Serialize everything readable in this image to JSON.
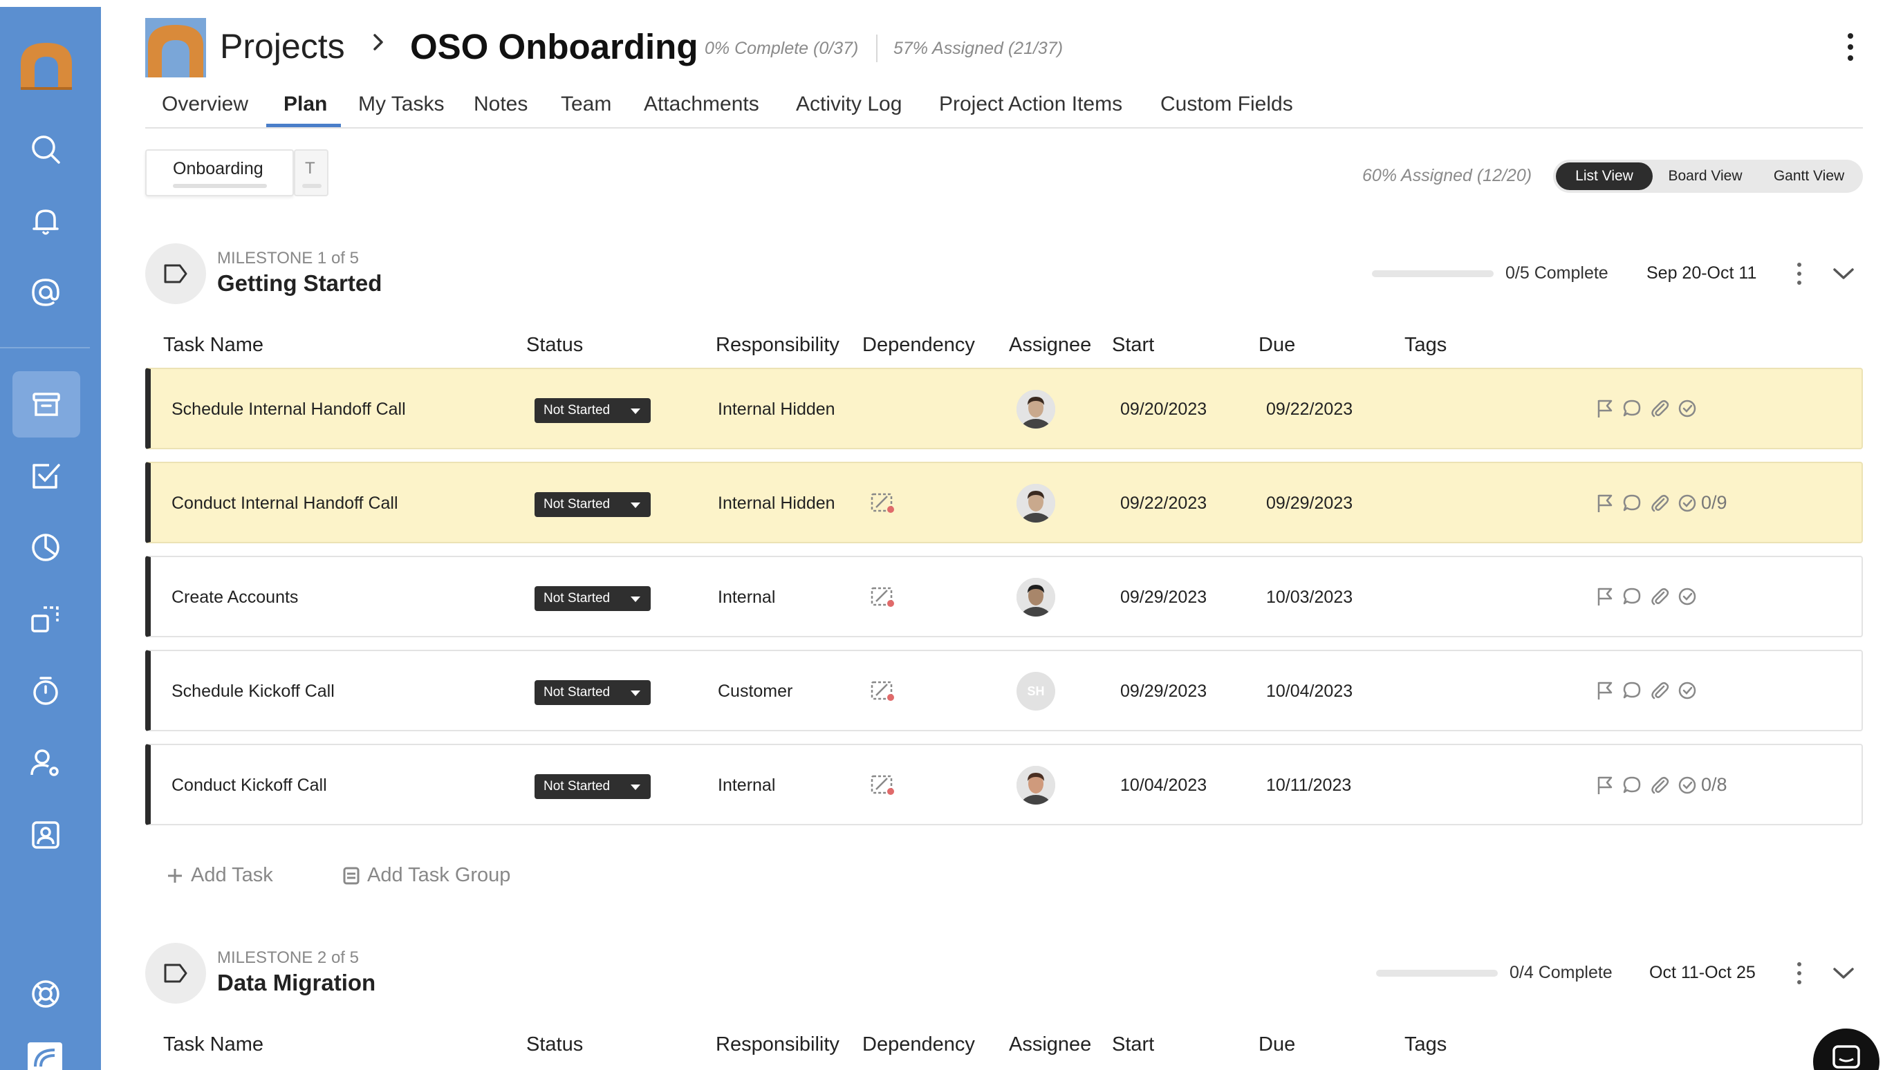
{
  "header": {
    "crumb_root": "Projects",
    "project_title": "OSO Onboarding",
    "complete_stat": "0% Complete (0/37)",
    "assigned_stat": "57% Assigned (21/37)"
  },
  "tabs": [
    "Overview",
    "Plan",
    "My Tasks",
    "Notes",
    "Team",
    "Attachments",
    "Activity Log",
    "Project Action Items",
    "Custom Fields"
  ],
  "active_tab": "Plan",
  "plan_tabs": {
    "first": "Onboarding",
    "second": "T"
  },
  "plan_assigned": "60% Assigned (12/20)",
  "views": {
    "list": "List View",
    "board": "Board View",
    "gantt": "Gantt View",
    "active": "List View"
  },
  "columns": {
    "task_name": "Task Name",
    "status": "Status",
    "responsibility": "Responsibility",
    "dependency": "Dependency",
    "assignee": "Assignee",
    "start": "Start",
    "due": "Due",
    "tags": "Tags"
  },
  "milestones": [
    {
      "label": "MILESTONE 1 of 5",
      "name": "Getting Started",
      "complete": "0/5 Complete",
      "dates": "Sep 20-Oct 11",
      "progress": 0
    },
    {
      "label": "MILESTONE 2 of 5",
      "name": "Data Migration",
      "complete": "0/4 Complete",
      "dates": "Oct 11-Oct 25",
      "progress": 0
    }
  ],
  "tasks": [
    {
      "name": "Schedule Internal Handoff Call",
      "status": "Not Started",
      "responsibility": "Internal Hidden",
      "dependency": false,
      "assignee": "avatar-1",
      "start": "09/20/2023",
      "due": "09/22/2023",
      "checklist": "",
      "highlight": true
    },
    {
      "name": "Conduct Internal Handoff Call",
      "status": "Not Started",
      "responsibility": "Internal Hidden",
      "dependency": true,
      "assignee": "avatar-1",
      "start": "09/22/2023",
      "due": "09/29/2023",
      "checklist": "0/9",
      "highlight": true
    },
    {
      "name": "Create Accounts",
      "status": "Not Started",
      "responsibility": "Internal",
      "dependency": true,
      "assignee": "avatar-2",
      "start": "09/29/2023",
      "due": "10/03/2023",
      "checklist": "",
      "highlight": false
    },
    {
      "name": "Schedule Kickoff Call",
      "status": "Not Started",
      "responsibility": "Customer",
      "dependency": true,
      "assignee": "SH",
      "start": "09/29/2023",
      "due": "10/04/2023",
      "checklist": "",
      "highlight": false
    },
    {
      "name": "Conduct Kickoff Call",
      "status": "Not Started",
      "responsibility": "Internal",
      "dependency": true,
      "assignee": "avatar-3",
      "start": "10/04/2023",
      "due": "10/11/2023",
      "checklist": "0/8",
      "highlight": false
    }
  ],
  "actions": {
    "add_task": "Add Task",
    "add_task_group": "Add Task Group"
  },
  "colors": {
    "sidebar": "#5b8fd0",
    "highlight_row": "#fcf3c9",
    "accent": "#4a7ec9",
    "brand_orange": "#d98a3a"
  }
}
